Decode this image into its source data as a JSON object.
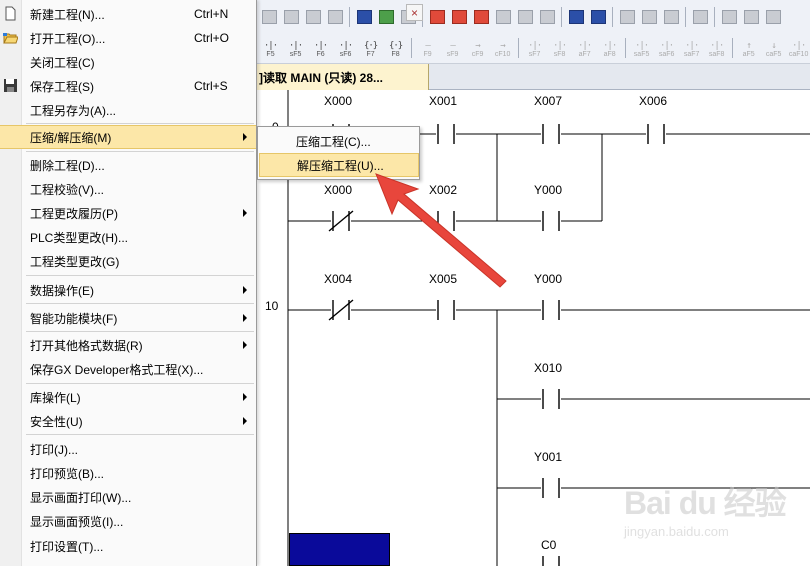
{
  "file_menu": {
    "items": [
      {
        "label": "新建工程(N)...",
        "shortcut": "Ctrl+N",
        "icon": "new-file-icon"
      },
      {
        "label": "打开工程(O)...",
        "shortcut": "Ctrl+O",
        "icon": "open-folder-icon"
      },
      {
        "label": "关闭工程(C)",
        "shortcut": ""
      },
      {
        "label": "保存工程(S)",
        "shortcut": "Ctrl+S",
        "icon": "save-disk-icon"
      },
      {
        "label": "工程另存为(A)...",
        "shortcut": ""
      },
      {
        "label": "压缩/解压缩(M)",
        "shortcut": "",
        "submenu": true,
        "highlighted": true
      },
      {
        "label": "删除工程(D)...",
        "shortcut": ""
      },
      {
        "label": "工程校验(V)...",
        "shortcut": ""
      },
      {
        "label": "工程更改履历(P)",
        "shortcut": "",
        "submenu": true
      },
      {
        "label": "PLC类型更改(H)...",
        "shortcut": ""
      },
      {
        "label": "工程类型更改(G)",
        "shortcut": ""
      },
      {
        "label": "数据操作(E)",
        "shortcut": "",
        "submenu": true
      },
      {
        "label": "智能功能模块(F)",
        "shortcut": "",
        "submenu": true
      },
      {
        "label": "打开其他格式数据(R)",
        "shortcut": "",
        "submenu": true
      },
      {
        "label": "保存GX Developer格式工程(X)...",
        "shortcut": ""
      },
      {
        "label": "库操作(L)",
        "shortcut": "",
        "submenu": true
      },
      {
        "label": "安全性(U)",
        "shortcut": "",
        "submenu": true
      },
      {
        "label": "打印(J)...",
        "shortcut": ""
      },
      {
        "label": "打印预览(B)...",
        "shortcut": ""
      },
      {
        "label": "显示画面打印(W)...",
        "shortcut": ""
      },
      {
        "label": "显示画面预览(I)...",
        "shortcut": ""
      },
      {
        "label": "打印设置(T)...",
        "shortcut": ""
      }
    ]
  },
  "submenu": {
    "items": [
      {
        "label": "压缩工程(C)..."
      },
      {
        "label": "解压缩工程(U)...",
        "highlighted": true
      }
    ]
  },
  "tab": {
    "label": "]读取 MAIN (只读) 28...",
    "close_glyph": "×"
  },
  "toolbar": {
    "fkeys": [
      {
        "sym": "·|·",
        "lbl": "F5"
      },
      {
        "sym": "·|·",
        "lbl": "sF5"
      },
      {
        "sym": "·|·",
        "lbl": "F6"
      },
      {
        "sym": "·|·",
        "lbl": "sF6"
      },
      {
        "sym": "{·}",
        "lbl": "F7"
      },
      {
        "sym": "{·}",
        "lbl": "F8"
      },
      {
        "sym": "—",
        "lbl": "F9",
        "dim": true
      },
      {
        "sym": "—",
        "lbl": "sF9",
        "dim": true
      },
      {
        "sym": "→",
        "lbl": "cF9",
        "dim": true
      },
      {
        "sym": "→",
        "lbl": "cF10",
        "dim": true
      },
      {
        "sym": "·|·",
        "lbl": "sF7",
        "dim": true
      },
      {
        "sym": "·|·",
        "lbl": "sF8",
        "dim": true
      },
      {
        "sym": "·|·",
        "lbl": "aF7",
        "dim": true
      },
      {
        "sym": "·|·",
        "lbl": "aF8",
        "dim": true
      },
      {
        "sym": "·|·",
        "lbl": "saF5",
        "dim": true
      },
      {
        "sym": "·|·",
        "lbl": "saF6",
        "dim": true
      },
      {
        "sym": "·|·",
        "lbl": "saF7",
        "dim": true
      },
      {
        "sym": "·|·",
        "lbl": "saF8",
        "dim": true
      },
      {
        "sym": "↑",
        "lbl": "aF5",
        "dim": true
      },
      {
        "sym": "↓",
        "lbl": "caF5",
        "dim": true
      },
      {
        "sym": "·|·",
        "lbl": "caF10",
        "dim": true
      }
    ]
  },
  "ladder": {
    "step_numbers": [
      "0",
      "10"
    ],
    "contacts": [
      {
        "label": "X000"
      },
      {
        "label": "X001"
      },
      {
        "label": "X007"
      },
      {
        "label": "X006"
      },
      {
        "label": "X000"
      },
      {
        "label": "X002"
      },
      {
        "label": "Y000"
      },
      {
        "label": "X004"
      },
      {
        "label": "X005"
      },
      {
        "label": "Y000"
      },
      {
        "label": "X010"
      },
      {
        "label": "Y001"
      },
      {
        "label": "C0"
      }
    ]
  },
  "watermark": {
    "main": "Bai du 经验",
    "sub": "jingyan.baidu.com"
  },
  "colors": {
    "highlight": "#fce7a8",
    "arrow": "#e8463c",
    "tab_active": "#fdf3cf",
    "blue_block": "#0a0a9a"
  }
}
